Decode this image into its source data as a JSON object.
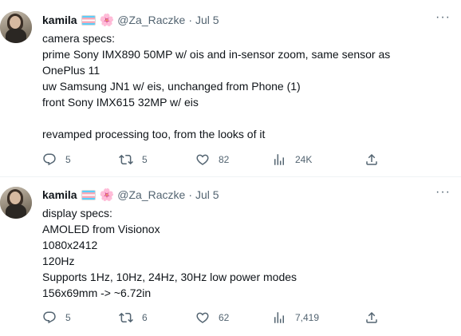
{
  "tweets": [
    {
      "author": {
        "name": "kamila",
        "handle": "@Za_Raczke",
        "date": "Jul 5",
        "separator": "·",
        "emoji": "🌸"
      },
      "text_lines": [
        "camera specs:",
        "prime Sony IMX890 50MP w/ ois and in-sensor zoom, same sensor as",
        "OnePlus 11",
        "uw Samsung JN1 w/ eis, unchanged from Phone (1)",
        "front Sony IMX615 32MP w/ eis",
        "",
        "revamped processing too, from the looks of it"
      ],
      "stats": {
        "replies": "5",
        "retweets": "5",
        "likes": "82",
        "views": "24K"
      }
    },
    {
      "author": {
        "name": "kamila",
        "handle": "@Za_Raczke",
        "date": "Jul 5",
        "separator": "·",
        "emoji": "🌸"
      },
      "text_lines": [
        "display specs:",
        "AMOLED from Visionox",
        "1080x2412",
        "120Hz",
        "Supports 1Hz, 10Hz, 24Hz, 30Hz low power modes",
        "156x69mm -> ~6.72in"
      ],
      "stats": {
        "replies": "5",
        "retweets": "6",
        "likes": "62",
        "views": "7,419"
      }
    }
  ],
  "icons": {
    "reply": "reply-icon",
    "retweet": "retweet-icon",
    "like": "heart-icon",
    "views": "views-chart-icon",
    "share": "share-icon",
    "more": "more-icon"
  },
  "colors": {
    "text_primary": "#0f1419",
    "text_secondary": "#536471",
    "divider": "#eff3f4"
  }
}
